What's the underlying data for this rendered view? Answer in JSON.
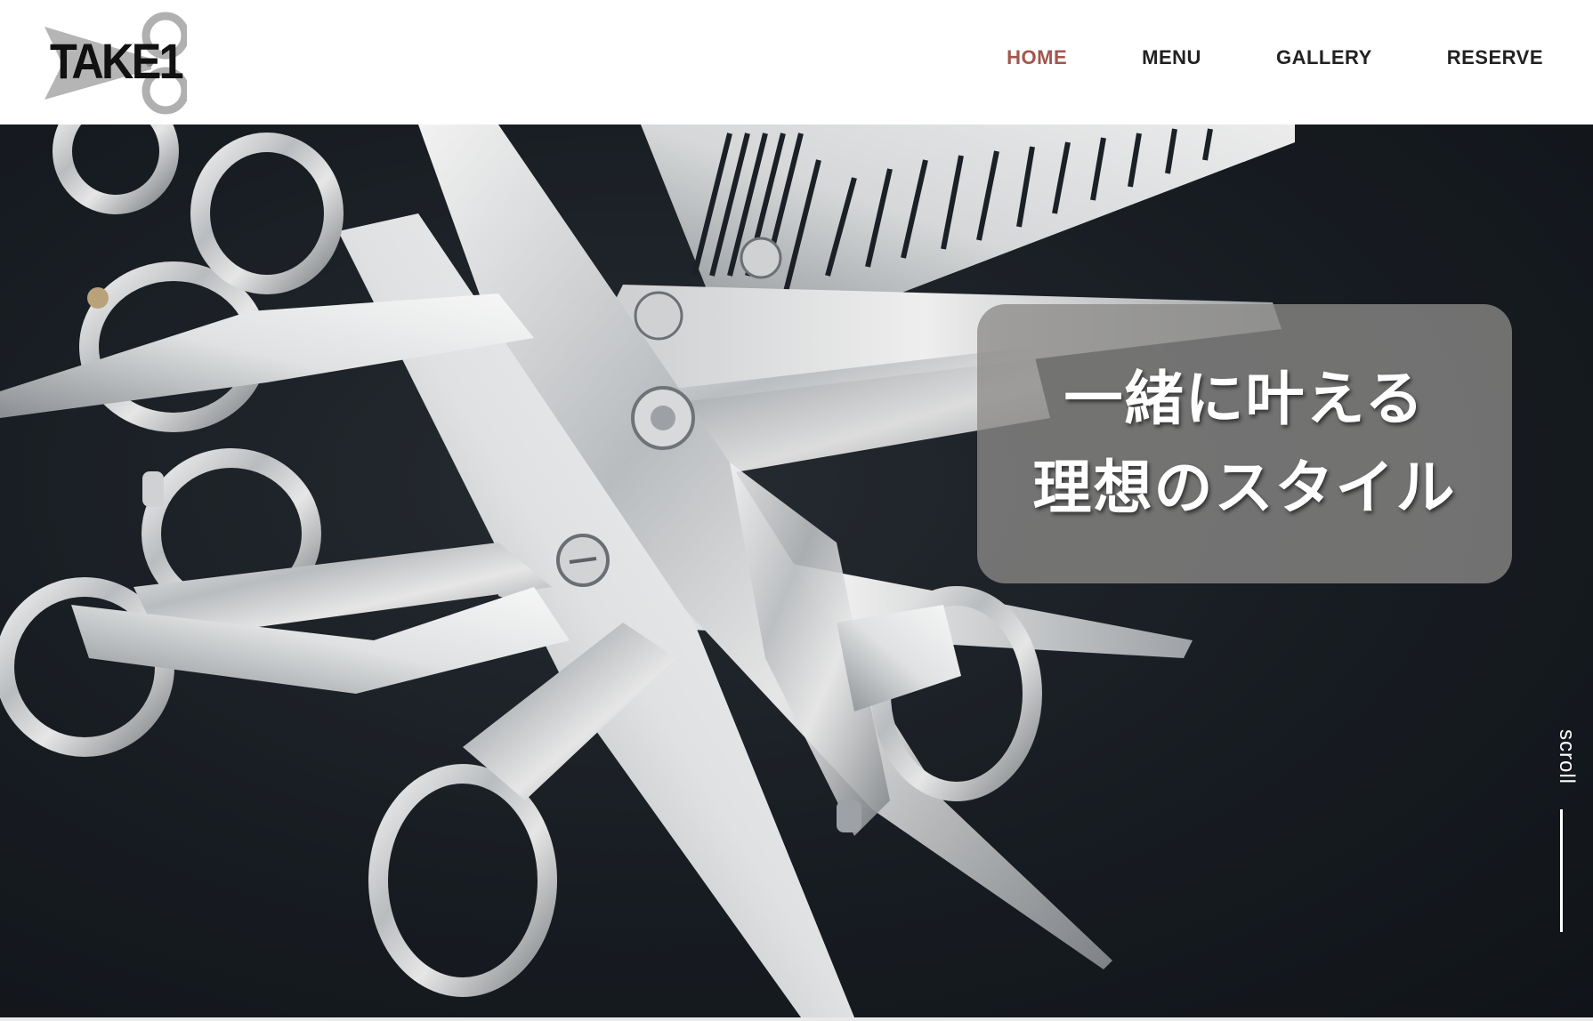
{
  "brand": {
    "logo_text": "TAKE1"
  },
  "nav": {
    "items": [
      {
        "label": "HOME",
        "active": true
      },
      {
        "label": "MENU",
        "active": false
      },
      {
        "label": "GALLERY",
        "active": false
      },
      {
        "label": "RESERVE",
        "active": false
      }
    ]
  },
  "hero": {
    "image_subject": "scissors-pile-photo",
    "tagline_line1": "一緒に叶える",
    "tagline_line2": "理想のスタイル",
    "scroll_label": "scroll"
  },
  "colors": {
    "nav_active": "#a2564f",
    "nav_default": "#222222",
    "tagline_box": "#8c8a88",
    "hero_bg": "#161b21"
  }
}
